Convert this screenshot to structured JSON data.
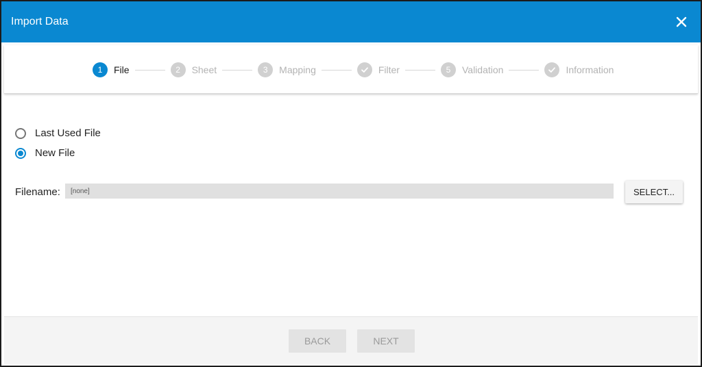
{
  "dialog": {
    "title": "Import Data",
    "close_icon": "close-icon",
    "accent_color": "#0a88d1"
  },
  "stepper": {
    "steps": [
      {
        "marker": "1",
        "label": "File",
        "active": true
      },
      {
        "marker": "2",
        "label": "Sheet",
        "active": false
      },
      {
        "marker": "3",
        "label": "Mapping",
        "active": false
      },
      {
        "marker": "check",
        "label": "Filter",
        "active": false
      },
      {
        "marker": "5",
        "label": "Validation",
        "active": false
      },
      {
        "marker": "check",
        "label": "Information",
        "active": false
      }
    ]
  },
  "file_source": {
    "options": [
      {
        "label": "Last Used File",
        "checked": false
      },
      {
        "label": "New File",
        "checked": true
      }
    ]
  },
  "filename": {
    "label": "Filename:",
    "value": "[none]",
    "select_label": "SELECT..."
  },
  "footer": {
    "back_label": "BACK",
    "next_label": "NEXT",
    "back_enabled": false,
    "next_enabled": false
  }
}
